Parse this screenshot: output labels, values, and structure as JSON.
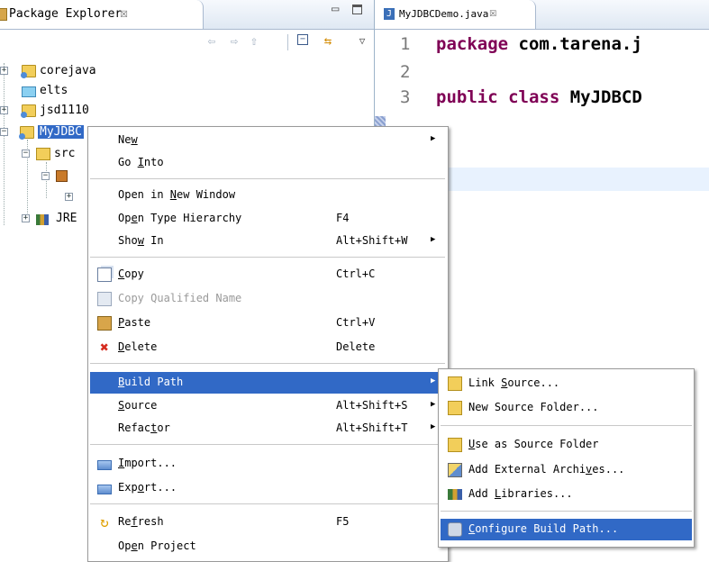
{
  "package_explorer": {
    "tab_label": "Package Explorer",
    "tab_close": "☒",
    "minimize": "▭",
    "tree": [
      {
        "label": "corejava",
        "expander": "+"
      },
      {
        "label": "elts",
        "expander": ""
      },
      {
        "label": "jsd1110",
        "expander": "+"
      },
      {
        "label": "MyJDBC",
        "expander": "−"
      },
      {
        "label": "src",
        "expander": "−"
      },
      {
        "label": "",
        "expander": "−"
      },
      {
        "label": "",
        "expander": "+"
      },
      {
        "label": "JRE",
        "expander": "+"
      }
    ]
  },
  "editor": {
    "tab_label": "MyJDBCDemo.java",
    "tab_icon": "J",
    "tab_close": "☒",
    "lines": [
      {
        "num": "1",
        "kw": "package",
        "rest": " com.tarena.j"
      },
      {
        "num": "2",
        "kw": "",
        "rest": ""
      },
      {
        "num": "3",
        "kw": "public class",
        "rest": " MyJDBCD"
      }
    ]
  },
  "context_menu": {
    "items": [
      {
        "label_pre": "Ne",
        "label_u": "w",
        "label_post": "",
        "accel": "",
        "arrow": "▶"
      },
      {
        "label_pre": "Go ",
        "label_u": "I",
        "label_post": "nto",
        "accel": ""
      },
      {
        "label_pre": "Open in ",
        "label_u": "N",
        "label_post": "ew Window",
        "accel": ""
      },
      {
        "label_pre": "Op",
        "label_u": "e",
        "label_post": "n Type Hierarchy",
        "accel": "F4"
      },
      {
        "label_pre": "Sho",
        "label_u": "w",
        "label_post": " In",
        "accel": "Alt+Shift+W",
        "arrow": "▶"
      },
      {
        "label_pre": "",
        "label_u": "C",
        "label_post": "opy",
        "accel": "Ctrl+C"
      },
      {
        "label_pre": "Copy Qualified Name",
        "label_u": "",
        "label_post": "",
        "accel": ""
      },
      {
        "label_pre": "",
        "label_u": "P",
        "label_post": "aste",
        "accel": "Ctrl+V"
      },
      {
        "label_pre": "",
        "label_u": "D",
        "label_post": "elete",
        "accel": "Delete",
        "icon": "✖"
      },
      {
        "label_pre": "",
        "label_u": "B",
        "label_post": "uild Path",
        "accel": "",
        "arrow": "▶"
      },
      {
        "label_pre": "",
        "label_u": "S",
        "label_post": "ource",
        "accel": "Alt+Shift+S",
        "arrow": "▶"
      },
      {
        "label_pre": "Refac",
        "label_u": "t",
        "label_post": "or",
        "accel": "Alt+Shift+T",
        "arrow": "▶"
      },
      {
        "label_pre": "",
        "label_u": "I",
        "label_post": "mport...",
        "accel": ""
      },
      {
        "label_pre": "Exp",
        "label_u": "o",
        "label_post": "rt...",
        "accel": ""
      },
      {
        "label_pre": "Re",
        "label_u": "f",
        "label_post": "resh",
        "accel": "F5",
        "icon": "↻"
      },
      {
        "label_pre": "Op",
        "label_u": "e",
        "label_post": "n Project",
        "accel": ""
      }
    ]
  },
  "build_path_submenu": {
    "items": [
      {
        "label_pre": "Link ",
        "label_u": "S",
        "label_post": "ource..."
      },
      {
        "label_pre": "New Source Folder...",
        "label_u": "",
        "label_post": ""
      },
      {
        "label_pre": "",
        "label_u": "U",
        "label_post": "se as Source Folder"
      },
      {
        "label_pre": "Add External Archi",
        "label_u": "v",
        "label_post": "es..."
      },
      {
        "label_pre": "Add ",
        "label_u": "L",
        "label_post": "ibraries..."
      },
      {
        "label_pre": "",
        "label_u": "C",
        "label_post": "onfigure Build Path..."
      }
    ]
  },
  "colors": {
    "selection": "#3169c6",
    "keyword": "#7f0055",
    "current_line": "#e8f2fe"
  }
}
